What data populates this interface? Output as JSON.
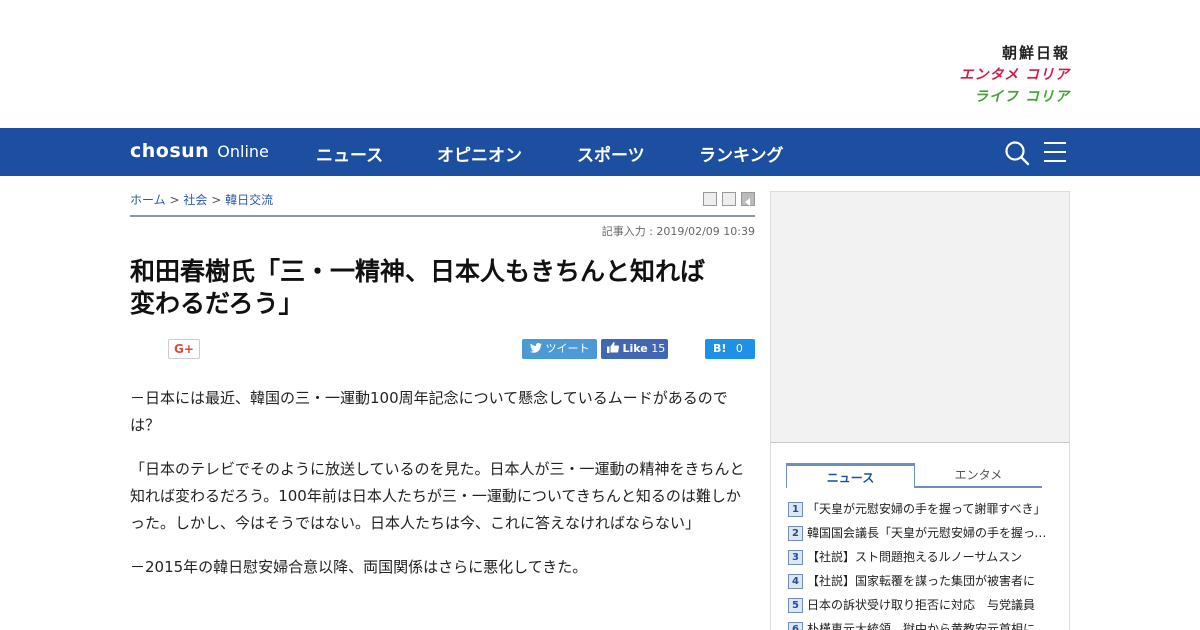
{
  "brand": {
    "chosun": "朝鮮日報",
    "enta": "エンタメ コリア",
    "life": "ライフ コリア"
  },
  "nav": {
    "logo_bold": "chosun",
    "logo_light": "Online",
    "items": [
      "ニュース",
      "オピニオン",
      "スポーツ",
      "ランキング"
    ]
  },
  "breadcrumb": {
    "home": "ホーム",
    "sep": ">",
    "section": "社会",
    "subsection": "韓日交流"
  },
  "article": {
    "posted": "記事入力 : 2019/02/09 10:39",
    "headline_line1": "和田春樹氏「三・一精神、日本人もきちんと知れば",
    "headline_line2": "変わるだろう」",
    "paragraphs": [
      "－日本には最近、韓国の三・一運動100周年記念について懸念しているムードがあるのでは？",
      "「日本のテレビでそのように放送しているのを見た。日本人が三・一運動の精神をきちんと知れば変わるだろう。100年前は日本人たちが三・一運動についてきちんと知るのは難しかった。しかし、今はそうではない。日本人たちは今、これに答えなければならない」",
      "－2015年の韓日慰安婦合意以降、両国関係はさらに悪化してきた。"
    ]
  },
  "share": {
    "gplus": "G+",
    "tweet": "ツイート",
    "fb_label": "Like",
    "fb_count": "15",
    "hb_label": "B!",
    "hb_count": "0"
  },
  "sidebar": {
    "tabs": [
      "ニュース",
      "エンタメ"
    ],
    "ranking": [
      {
        "num": "1",
        "title": "「天皇が元慰安婦の手を握って謝罪すべき」"
      },
      {
        "num": "2",
        "title": "韓国国会議長「天皇が元慰安婦の手を握って」"
      },
      {
        "num": "3",
        "title": "【社説】スト問題抱えるルノーサムスン"
      },
      {
        "num": "4",
        "title": "【社説】国家転覆を謀った集団が被害者に"
      },
      {
        "num": "5",
        "title": "日本の訴状受け取り拒否に対応　与党議員"
      },
      {
        "num": "6",
        "title": "朴槿恵元大統領、獄中から黄教安元首相に"
      }
    ]
  },
  "colors": {
    "nav_bg": "#1c4f9f",
    "enta": "#d8194a",
    "life": "#43a435"
  }
}
